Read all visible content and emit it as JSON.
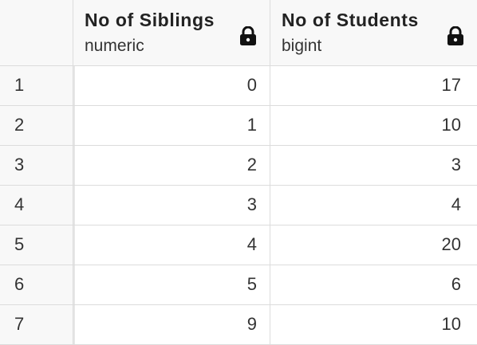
{
  "columns": [
    {
      "name": "No of Siblings",
      "type": "numeric",
      "icon": "lock-icon"
    },
    {
      "name": "No of Students",
      "type": "bigint",
      "icon": "lock-icon"
    }
  ],
  "rows": [
    {
      "row_number": "1",
      "siblings": "0",
      "students": "17"
    },
    {
      "row_number": "2",
      "siblings": "1",
      "students": "10"
    },
    {
      "row_number": "3",
      "siblings": "2",
      "students": "3"
    },
    {
      "row_number": "4",
      "siblings": "3",
      "students": "4"
    },
    {
      "row_number": "5",
      "siblings": "4",
      "students": "20"
    },
    {
      "row_number": "6",
      "siblings": "5",
      "students": "6"
    },
    {
      "row_number": "7",
      "siblings": "9",
      "students": "10"
    }
  ]
}
